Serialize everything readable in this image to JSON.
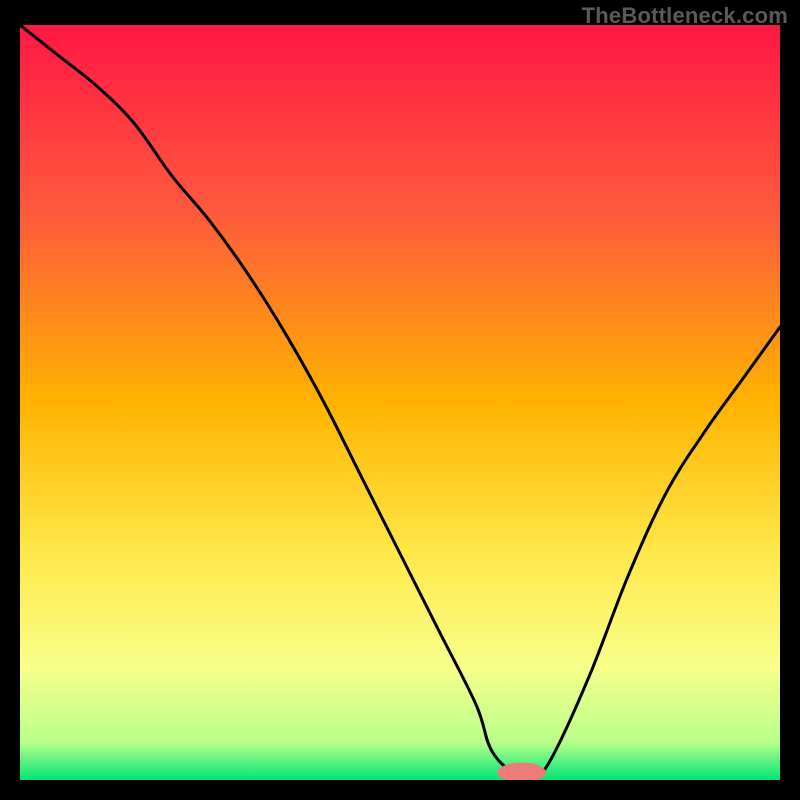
{
  "watermark": "TheBottleneck.com",
  "chart_data": {
    "type": "line",
    "title": "",
    "xlabel": "",
    "ylabel": "",
    "xlim": [
      0,
      100
    ],
    "ylim": [
      0,
      100
    ],
    "grid": false,
    "legend": false,
    "background": "vertical-gradient",
    "gradient_stops": [
      {
        "pos": 0.0,
        "color": "#ff1744"
      },
      {
        "pos": 0.25,
        "color": "#ff5a3c"
      },
      {
        "pos": 0.5,
        "color": "#ffb300"
      },
      {
        "pos": 0.7,
        "color": "#ffe84a"
      },
      {
        "pos": 0.85,
        "color": "#f8ff8a"
      },
      {
        "pos": 0.95,
        "color": "#b8ff8a"
      },
      {
        "pos": 1.0,
        "color": "#00e676"
      }
    ],
    "series": [
      {
        "name": "bottleneck-curve",
        "color": "#000000",
        "x": [
          0,
          5,
          10,
          15,
          20,
          25,
          30,
          35,
          40,
          45,
          50,
          55,
          60,
          62,
          65,
          68,
          70,
          75,
          80,
          85,
          90,
          95,
          100
        ],
        "y": [
          100,
          96,
          92,
          87,
          80,
          74,
          67,
          59,
          50,
          40,
          30,
          20,
          10,
          4,
          1,
          1,
          3,
          14,
          27,
          38,
          46,
          53,
          60
        ]
      }
    ],
    "marker": {
      "name": "optimal-marker",
      "x": 66,
      "y": 1,
      "color": "#ee7a7a",
      "rx": 3.2,
      "ry": 1.3
    }
  }
}
